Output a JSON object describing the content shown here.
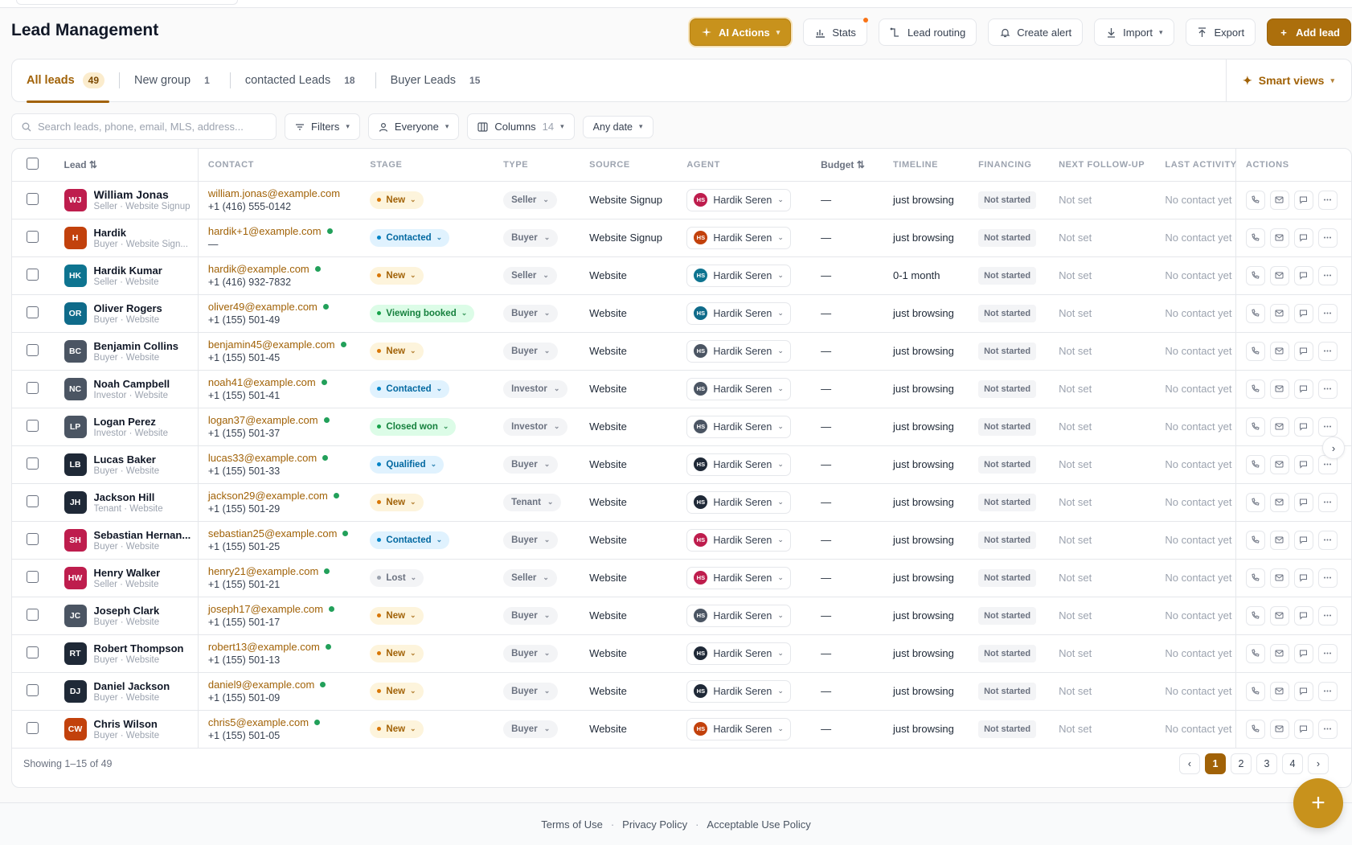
{
  "page_title": "Lead Management",
  "toolbar": {
    "ai_actions": "AI Actions",
    "stats": "Stats",
    "lead_routing": "Lead routing",
    "create_alert": "Create alert",
    "import": "Import",
    "export": "Export",
    "add_lead": "Add lead"
  },
  "tabs": [
    {
      "label": "All leads",
      "count": "49"
    },
    {
      "label": "New group",
      "count": "1"
    },
    {
      "label": "contacted Leads",
      "count": "18"
    },
    {
      "label": "Buyer Leads",
      "count": "15"
    }
  ],
  "smart_views": "Smart views",
  "filters": {
    "search_placeholder": "Search leads, phone, email, MLS, address...",
    "filters": "Filters",
    "everyone": "Everyone",
    "columns": "Columns",
    "columns_count": "14",
    "date": "Any date"
  },
  "columns": {
    "lead": "Lead",
    "contact": "Contact",
    "stage": "Stage",
    "type": "Type",
    "source": "Source",
    "agent": "Agent",
    "budget": "Budget",
    "timeline": "Timeline",
    "financing": "Financing",
    "follow_up": "Next follow-up",
    "last_activity": "Last activity",
    "actions": "Actions"
  },
  "rows": [
    {
      "initials": "WJ",
      "color": "#be1d4d",
      "name": "William Jonas",
      "sub": "Seller · Website Signup",
      "email": "william.jonas@example.com",
      "phone": "+1 (416) 555-0142",
      "stage": "New",
      "type": "Seller",
      "source": "Website Signup",
      "agent": "Hardik Seren",
      "agent_color": "#be1d4d",
      "budget": "—",
      "timeline": "just browsing",
      "financing": "Not started",
      "follow": "Not set",
      "activity": "No contact yet"
    },
    {
      "initials": "H",
      "color": "#c2410c",
      "name": "Hardik",
      "sub": "Buyer · Website Sign...",
      "email": "hardik+1@example.com",
      "phone": "—",
      "stage": "Contacted",
      "type": "Buyer",
      "source": "Website Signup",
      "agent": "Hardik Seren",
      "agent_color": "#c2410c",
      "budget": "—",
      "timeline": "just browsing",
      "financing": "Not started",
      "follow": "Not set",
      "activity": "No contact yet"
    },
    {
      "initials": "HK",
      "color": "#0e7490",
      "name": "Hardik Kumar",
      "sub": "Seller · Website",
      "email": "hardik@example.com",
      "phone": "+1 (416) 932-7832",
      "stage": "New",
      "type": "Seller",
      "source": "Website",
      "agent": "Hardik Seren",
      "agent_color": "#0e7490",
      "budget": "—",
      "timeline": "0-1 month",
      "financing": "Not started",
      "follow": "Not set",
      "activity": "No contact yet"
    },
    {
      "initials": "OR",
      "color": "#0f6b8a",
      "name": "Oliver Rogers",
      "sub": "Buyer · Website",
      "email": "oliver49@example.com",
      "phone": "+1 (155) 501-49",
      "stage": "Viewing booked",
      "type": "Buyer",
      "source": "Website",
      "agent": "Hardik Seren",
      "agent_color": "#0f6b8a",
      "budget": "—",
      "timeline": "just browsing",
      "financing": "Not started",
      "follow": "Not set",
      "activity": "No contact yet"
    },
    {
      "initials": "BC",
      "color": "#4b5563",
      "name": "Benjamin Collins",
      "sub": "Buyer · Website",
      "email": "benjamin45@example.com",
      "phone": "+1 (155) 501-45",
      "stage": "New",
      "type": "Buyer",
      "source": "Website",
      "agent": "Hardik Seren",
      "agent_color": "#4b5563",
      "budget": "—",
      "timeline": "just browsing",
      "financing": "Not started",
      "follow": "Not set",
      "activity": "No contact yet"
    },
    {
      "initials": "NC",
      "color": "#4b5563",
      "name": "Noah Campbell",
      "sub": "Investor · Website",
      "email": "noah41@example.com",
      "phone": "+1 (155) 501-41",
      "stage": "Contacted",
      "type": "Investor",
      "source": "Website",
      "agent": "Hardik Seren",
      "agent_color": "#4b5563",
      "budget": "—",
      "timeline": "just browsing",
      "financing": "Not started",
      "follow": "Not set",
      "activity": "No contact yet"
    },
    {
      "initials": "LP",
      "color": "#4b5563",
      "name": "Logan Perez",
      "sub": "Investor · Website",
      "email": "logan37@example.com",
      "phone": "+1 (155) 501-37",
      "stage": "Closed won",
      "type": "Investor",
      "source": "Website",
      "agent": "Hardik Seren",
      "agent_color": "#4b5563",
      "budget": "—",
      "timeline": "just browsing",
      "financing": "Not started",
      "follow": "Not set",
      "activity": "No contact yet"
    },
    {
      "initials": "LB",
      "color": "#1f2937",
      "name": "Lucas Baker",
      "sub": "Buyer · Website",
      "email": "lucas33@example.com",
      "phone": "+1 (155) 501-33",
      "stage": "Qualified",
      "type": "Buyer",
      "source": "Website",
      "agent": "Hardik Seren",
      "agent_color": "#1f2937",
      "budget": "—",
      "timeline": "just browsing",
      "financing": "Not started",
      "follow": "Not set",
      "activity": "No contact yet"
    },
    {
      "initials": "JH",
      "color": "#1f2937",
      "name": "Jackson Hill",
      "sub": "Tenant · Website",
      "email": "jackson29@example.com",
      "phone": "+1 (155) 501-29",
      "stage": "New",
      "type": "Tenant",
      "source": "Website",
      "agent": "Hardik Seren",
      "agent_color": "#1f2937",
      "budget": "—",
      "timeline": "just browsing",
      "financing": "Not started",
      "follow": "Not set",
      "activity": "No contact yet"
    },
    {
      "initials": "SH",
      "color": "#be1d4d",
      "name": "Sebastian Hernan...",
      "sub": "Buyer · Website",
      "email": "sebastian25@example.com",
      "phone": "+1 (155) 501-25",
      "stage": "Contacted",
      "type": "Buyer",
      "source": "Website",
      "agent": "Hardik Seren",
      "agent_color": "#be1d4d",
      "budget": "—",
      "timeline": "just browsing",
      "financing": "Not started",
      "follow": "Not set",
      "activity": "No contact yet"
    },
    {
      "initials": "HW",
      "color": "#be1d4d",
      "name": "Henry Walker",
      "sub": "Seller · Website",
      "email": "henry21@example.com",
      "phone": "+1 (155) 501-21",
      "stage": "Lost",
      "type": "Seller",
      "source": "Website",
      "agent": "Hardik Seren",
      "agent_color": "#be1d4d",
      "budget": "—",
      "timeline": "just browsing",
      "financing": "Not started",
      "follow": "Not set",
      "activity": "No contact yet"
    },
    {
      "initials": "JC",
      "color": "#4b5563",
      "name": "Joseph Clark",
      "sub": "Buyer · Website",
      "email": "joseph17@example.com",
      "phone": "+1 (155) 501-17",
      "stage": "New",
      "type": "Buyer",
      "source": "Website",
      "agent": "Hardik Seren",
      "agent_color": "#4b5563",
      "budget": "—",
      "timeline": "just browsing",
      "financing": "Not started",
      "follow": "Not set",
      "activity": "No contact yet"
    },
    {
      "initials": "RT",
      "color": "#1f2937",
      "name": "Robert Thompson",
      "sub": "Buyer · Website",
      "email": "robert13@example.com",
      "phone": "+1 (155) 501-13",
      "stage": "New",
      "type": "Buyer",
      "source": "Website",
      "agent": "Hardik Seren",
      "agent_color": "#1f2937",
      "budget": "—",
      "timeline": "just browsing",
      "financing": "Not started",
      "follow": "Not set",
      "activity": "No contact yet"
    },
    {
      "initials": "DJ",
      "color": "#1f2937",
      "name": "Daniel Jackson",
      "sub": "Buyer · Website",
      "email": "daniel9@example.com",
      "phone": "+1 (155) 501-09",
      "stage": "New",
      "type": "Buyer",
      "source": "Website",
      "agent": "Hardik Seren",
      "agent_color": "#1f2937",
      "budget": "—",
      "timeline": "just browsing",
      "financing": "Not started",
      "follow": "Not set",
      "activity": "No contact yet"
    },
    {
      "initials": "CW",
      "color": "#c2410c",
      "name": "Chris Wilson",
      "sub": "Buyer · Website",
      "email": "chris5@example.com",
      "phone": "+1 (155) 501-05",
      "stage": "New",
      "type": "Buyer",
      "source": "Website",
      "agent": "Hardik Seren",
      "agent_color": "#c2410c",
      "budget": "—",
      "timeline": "just browsing",
      "financing": "Not started",
      "follow": "Not set",
      "activity": "No contact yet"
    }
  ],
  "agent_initials": "HS",
  "stage_styles": {
    "New": {
      "bg": "#fdf4dc",
      "fg": "#a16207",
      "dot": "#d97706"
    },
    "Contacted": {
      "bg": "#e0f2fe",
      "fg": "#0369a1",
      "dot": "#0284c7"
    },
    "Viewing booked": {
      "bg": "#dcfce7",
      "fg": "#15803d",
      "dot": "#16a34a"
    },
    "Closed won": {
      "bg": "#dcfce7",
      "fg": "#15803d",
      "dot": "#16a34a"
    },
    "Qualified": {
      "bg": "#e0f2fe",
      "fg": "#0369a1",
      "dot": "#0284c7"
    },
    "Lost": {
      "bg": "#f3f4f6",
      "fg": "#6b7280",
      "dot": "#9ca3af"
    }
  },
  "pagination": {
    "showing": "Showing 1–15 of 49",
    "pages": [
      "1",
      "2",
      "3",
      "4"
    ],
    "current": "1"
  },
  "footer": {
    "terms": "Terms of Use",
    "privacy": "Privacy Policy",
    "aup": "Acceptable Use Policy",
    "sep": "·"
  }
}
